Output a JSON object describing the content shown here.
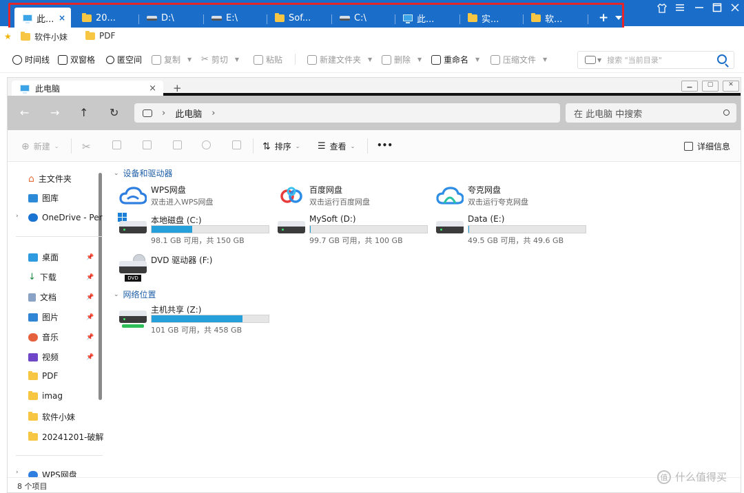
{
  "colors": {
    "accent": "#1a6ec9",
    "highlight": "#e5252a",
    "usage_bar": "#26a0da"
  },
  "top_tabs": [
    {
      "label": "此...",
      "icon": "monitor-icon",
      "active": true
    },
    {
      "label": "20...",
      "icon": "folder-icon"
    },
    {
      "label": "D:\\",
      "icon": "drive-icon"
    },
    {
      "label": "E:\\",
      "icon": "drive-icon"
    },
    {
      "label": "Sof...",
      "icon": "folder-icon"
    },
    {
      "label": "C:\\",
      "icon": "drive-icon"
    },
    {
      "label": "此...",
      "icon": "monitor-icon"
    },
    {
      "label": "实...",
      "icon": "folder-icon"
    },
    {
      "label": "软...",
      "icon": "folder-icon"
    }
  ],
  "top_tab_close": "×",
  "top_tab_add": "+",
  "bookmarks": [
    "软件小妹",
    "PDF"
  ],
  "toolbar": {
    "timeline": "时间线",
    "dual_pane": "双窗格",
    "blank_space": "匿空间",
    "copy": "复制",
    "cut": "剪切",
    "paste": "粘贴",
    "new_folder": "新建文件夹",
    "delete": "删除",
    "rename": "重命名",
    "compress": "压缩文件",
    "search_placeholder": "搜索 \"当前目录\""
  },
  "inner": {
    "tab_label": "此电脑",
    "tab_close": "×",
    "tab_add": "+",
    "breadcrumb": "此电脑",
    "search_placeholder": "在 此电脑 中搜索",
    "commands": {
      "new": "新建",
      "sort": "排序",
      "view": "查看",
      "more": "•••",
      "details": "详细信息"
    }
  },
  "sidebar": {
    "items": [
      {
        "label": "主文件夹",
        "icon": "home-icon"
      },
      {
        "label": "图库",
        "icon": "gallery-icon"
      },
      {
        "label": "OneDrive - Per",
        "icon": "onedrive-icon"
      },
      {
        "label": "桌面",
        "icon": "desktop-icon"
      },
      {
        "label": "下载",
        "icon": "download-icon"
      },
      {
        "label": "文档",
        "icon": "document-icon"
      },
      {
        "label": "图片",
        "icon": "pictures-icon"
      },
      {
        "label": "音乐",
        "icon": "music-icon"
      },
      {
        "label": "视频",
        "icon": "video-icon"
      },
      {
        "label": "PDF",
        "icon": "folder-icon"
      },
      {
        "label": "imag",
        "icon": "folder-icon"
      },
      {
        "label": "软件小妹",
        "icon": "folder-icon"
      },
      {
        "label": "20241201-破解",
        "icon": "folder-icon"
      },
      {
        "label": "WPS网盘",
        "icon": "wps-cloud-icon"
      }
    ]
  },
  "content": {
    "group_devices": "设备和驱动器",
    "group_network": "网络位置",
    "clouds": [
      {
        "name": "WPS网盘",
        "sub": "双击进入WPS网盘",
        "icon": "wps-cloud-icon"
      },
      {
        "name": "百度网盘",
        "sub": "双击运行百度网盘",
        "icon": "baidu-cloud-icon"
      },
      {
        "name": "夸克网盘",
        "sub": "双击运行夸克网盘",
        "icon": "quark-cloud-icon"
      }
    ],
    "drives": [
      {
        "name": "本地磁盘 (C:)",
        "info": "98.1 GB 可用，共 150 GB",
        "used_fraction": 0.346
      },
      {
        "name": "MySoft (D:)",
        "info": "99.7 GB 可用，共 100 GB",
        "used_fraction": 0.003
      },
      {
        "name": "Data (E:)",
        "info": "49.5 GB 可用，共 49.6 GB",
        "used_fraction": 0.002
      }
    ],
    "dvd": {
      "name": "DVD 驱动器 (F:)",
      "badge": "DVD"
    },
    "network_drive": {
      "name": "主机共享 (Z:)",
      "info": "101 GB 可用，共 458 GB",
      "used_fraction": 0.779
    }
  },
  "status": {
    "items": "8 个项目"
  },
  "watermark": {
    "text": "什么值得买",
    "badge": "值"
  }
}
